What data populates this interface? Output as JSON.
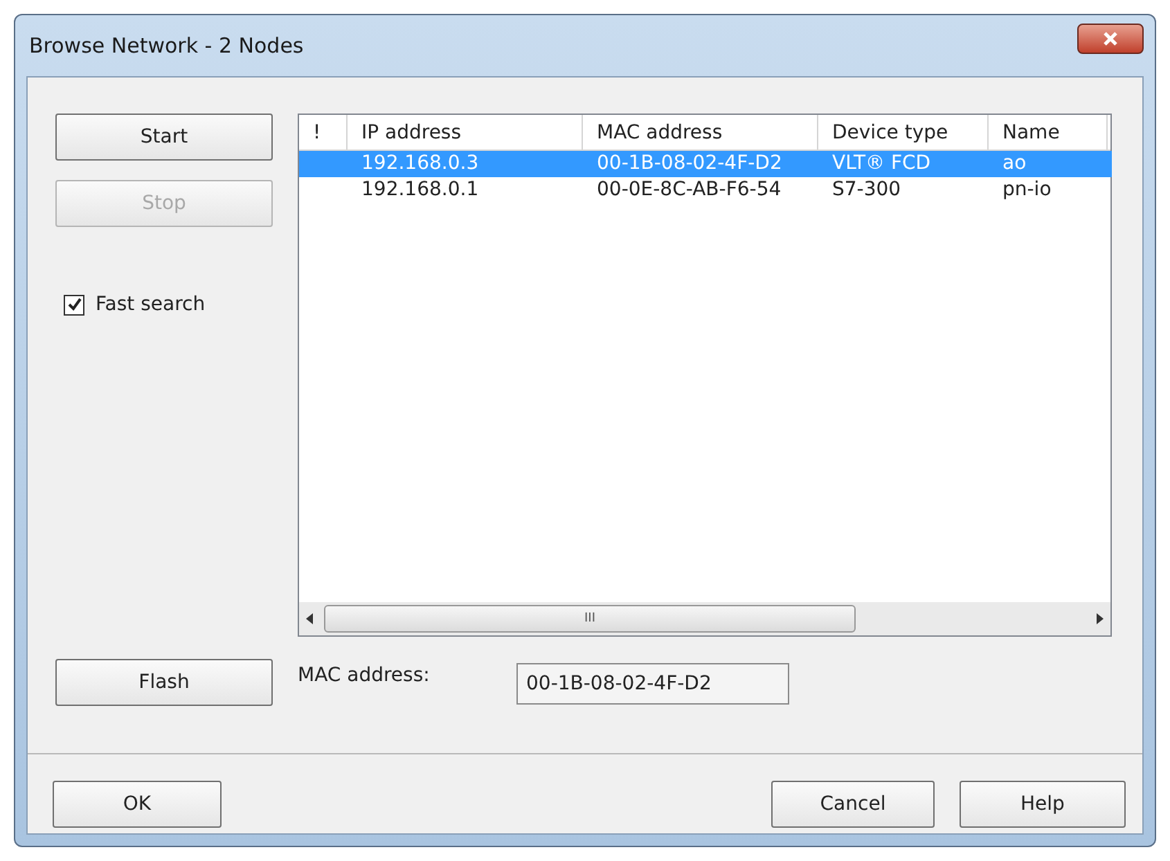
{
  "window": {
    "title": "Browse Network - 2 Nodes"
  },
  "buttons_left": [
    {
      "label": "Start",
      "disabled": false
    },
    {
      "label": "Stop",
      "disabled": true
    }
  ],
  "fast_search": {
    "label": "Fast search",
    "checked": true
  },
  "table": {
    "columns": [
      "!",
      "IP address",
      "MAC address",
      "Device type",
      "Name"
    ],
    "rows": [
      {
        "cells": [
          "",
          "192.168.0.3",
          "00-1B-08-02-4F-D2",
          "VLT® FCD",
          "ao"
        ],
        "selected": true
      },
      {
        "cells": [
          "",
          "192.168.0.1",
          "00-0E-8C-AB-F6-54",
          "S7-300",
          "pn-io"
        ],
        "selected": false
      }
    ],
    "scroll_thumb": "III"
  },
  "flash_button": "Flash",
  "mac_field": {
    "label": "MAC address:",
    "value": "00-1B-08-02-4F-D2"
  },
  "footer_buttons": [
    "OK",
    "Cancel",
    "Help"
  ]
}
